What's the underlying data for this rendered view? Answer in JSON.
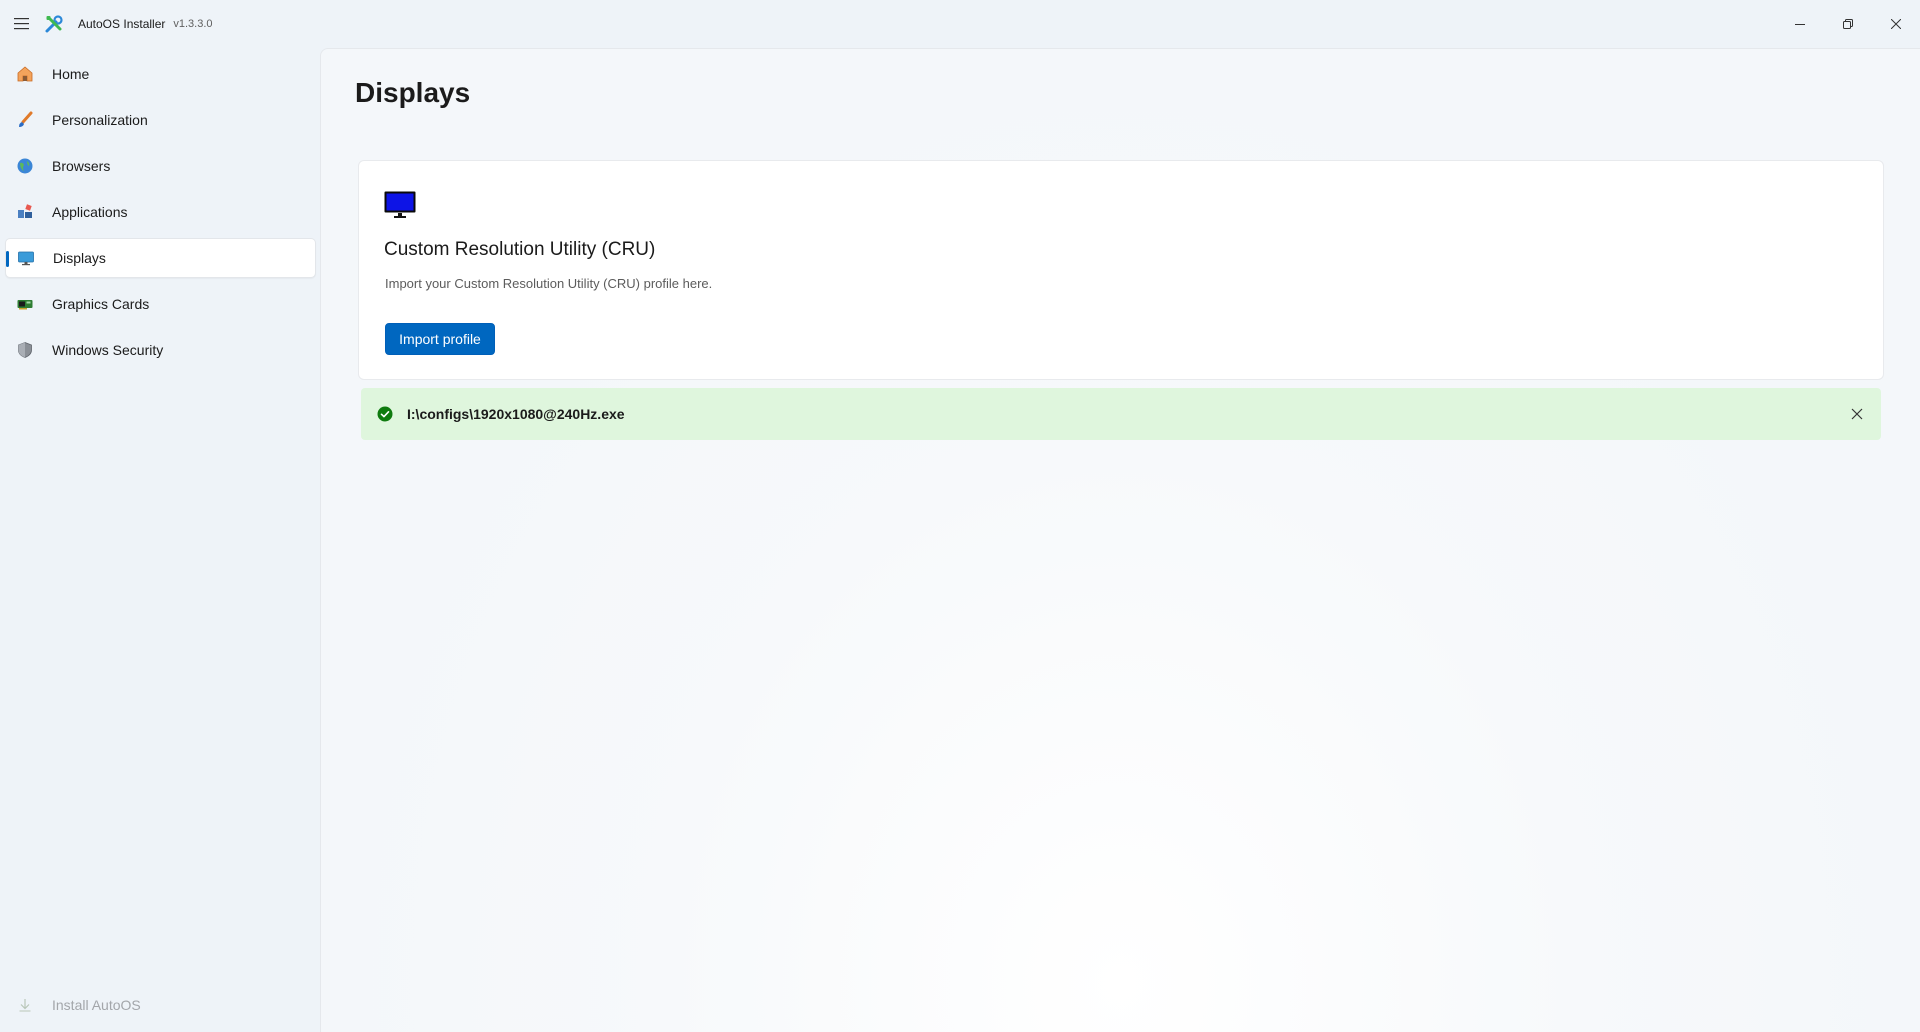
{
  "app": {
    "title": "AutoOS Installer",
    "version": "v1.3.3.0",
    "icon": "wrench-screwdriver-icon"
  },
  "window_controls": [
    "minimize-icon",
    "restore-icon",
    "close-icon"
  ],
  "sidebar": {
    "items": [
      {
        "label": "Home",
        "icon": "home-icon"
      },
      {
        "label": "Personalization",
        "icon": "brush-icon"
      },
      {
        "label": "Browsers",
        "icon": "globe-icon"
      },
      {
        "label": "Applications",
        "icon": "apps-icon"
      },
      {
        "label": "Displays",
        "icon": "monitor-icon",
        "selected": true
      },
      {
        "label": "Graphics Cards",
        "icon": "gpu-icon"
      },
      {
        "label": "Windows Security",
        "icon": "shield-icon"
      }
    ],
    "footer": {
      "label": "Install AutoOS",
      "icon": "download-icon",
      "disabled": true
    }
  },
  "page": {
    "title": "Displays",
    "card": {
      "icon": "monitor-icon",
      "title": "Custom Resolution Utility (CRU)",
      "description": "Import your Custom Resolution Utility (CRU) profile here.",
      "button_label": "Import profile"
    },
    "infobar": {
      "severity": "success",
      "message": "I:\\configs\\1920x1080@240Hz.exe",
      "icon": "check-circle-icon"
    }
  },
  "colors": {
    "accent": "#0067c0",
    "success_bg": "#dff6dd",
    "success_icon": "#0f7b0f"
  }
}
